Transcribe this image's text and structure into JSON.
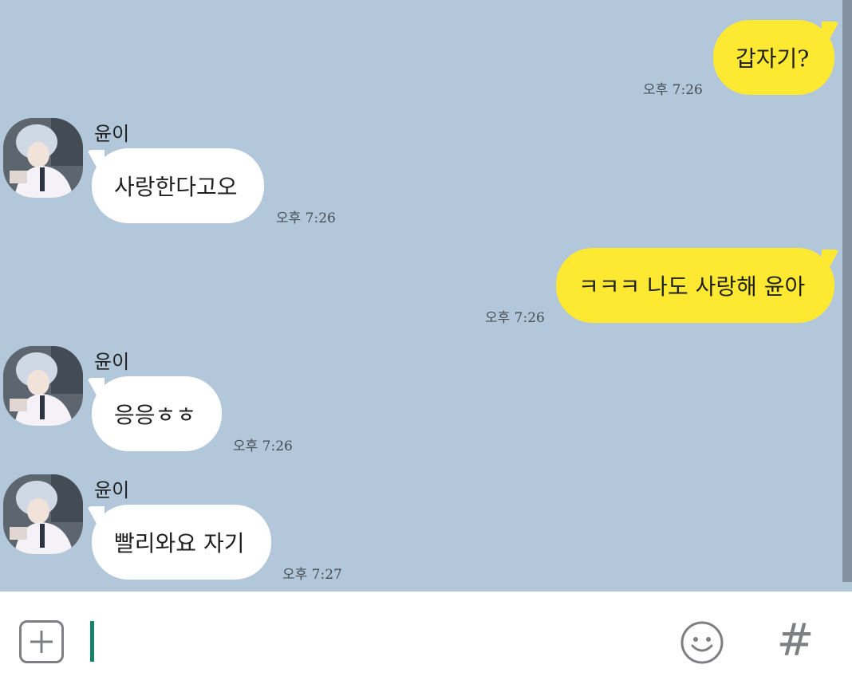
{
  "messages": [
    {
      "direction": "out",
      "text": "갑자기?",
      "time": "오후 7:26"
    },
    {
      "direction": "in",
      "sender": "윤이",
      "text": "사랑한다고오",
      "time": "오후 7:26"
    },
    {
      "direction": "out",
      "text": "ㅋㅋㅋ 나도 사랑해 윤아",
      "time": "오후 7:26"
    },
    {
      "direction": "in",
      "sender": "윤이",
      "text": "응응ㅎㅎ",
      "time": "오후 7:26"
    },
    {
      "direction": "in",
      "sender": "윤이",
      "text": "빨리와요 자기",
      "time": "오후 7:27"
    }
  ],
  "input": {
    "value": "",
    "icons": [
      "plus-icon",
      "emoji-icon",
      "hashtag-icon"
    ],
    "hash_symbol": "#"
  },
  "colors": {
    "chat_background": "#b2c7da",
    "my_bubble": "#fee932",
    "other_bubble": "#ffffff",
    "caret": "#15836a"
  }
}
